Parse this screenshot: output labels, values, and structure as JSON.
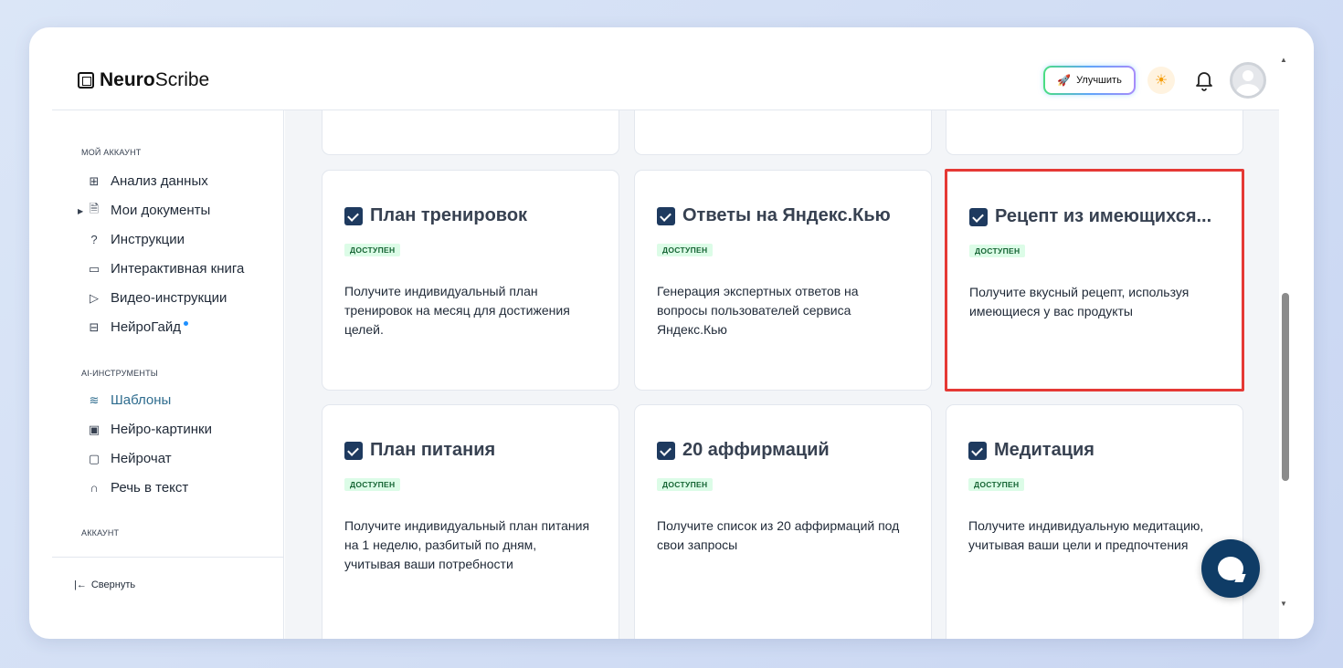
{
  "header": {
    "logo_bold": "Neuro",
    "logo_rest": "Scribe",
    "upgrade_label": "Улучшить",
    "upgrade_icon": "rocket-icon",
    "theme_icon": "sun-icon",
    "bell_icon": "bell-icon"
  },
  "sidebar": {
    "section_account": "МОЙ АККАУНТ",
    "items_account": [
      {
        "label": "Анализ данных",
        "icon": "grid-icon"
      },
      {
        "label": "Мои документы",
        "icon": "document-icon"
      },
      {
        "label": "Инструкции",
        "icon": "help-icon"
      },
      {
        "label": "Интерактивная книга",
        "icon": "book-icon"
      },
      {
        "label": "Видео-инструкции",
        "icon": "video-icon"
      },
      {
        "label": "НейроГайд",
        "icon": "guide-icon"
      }
    ],
    "section_ai": "AI-ИНСТРУМЕНТЫ",
    "items_ai": [
      {
        "label": "Шаблоны",
        "icon": "layers-icon",
        "active": true
      },
      {
        "label": "Нейро-картинки",
        "icon": "image-icon"
      },
      {
        "label": "Нейрочат",
        "icon": "chat-icon"
      },
      {
        "label": "Речь в текст",
        "icon": "headphones-icon"
      }
    ],
    "section_acc2": "АККАУНТ",
    "collapse_label": "Свернуть"
  },
  "cards": [
    {
      "title": "План тренировок",
      "badge": "ДОСТУПЕН",
      "desc": "Получите индивидуальный план тренировок на месяц для достижения целей."
    },
    {
      "title": "Ответы на Яндекс.Кью",
      "badge": "ДОСТУПЕН",
      "desc": "Генерация экспертных ответов на вопросы пользователей сервиса Яндекс.Кью"
    },
    {
      "title": "Рецепт из имеющихся...",
      "badge": "ДОСТУПЕН",
      "desc": "Получите вкусный рецепт, используя имеющиеся у вас продукты"
    },
    {
      "title": "План питания",
      "badge": "ДОСТУПЕН",
      "desc": "Получите индивидуальный план питания на 1 неделю, разбитый по дням, учитывая ваши потребности"
    },
    {
      "title": "20 аффирмаций",
      "badge": "ДОСТУПЕН",
      "desc": "Получите список из 20 аффирмаций под свои запросы"
    },
    {
      "title": "Медитация",
      "badge": "ДОСТУПЕН",
      "desc": "Получите индивидуальную медитацию, учитывая ваши цели и предпочтения"
    }
  ]
}
